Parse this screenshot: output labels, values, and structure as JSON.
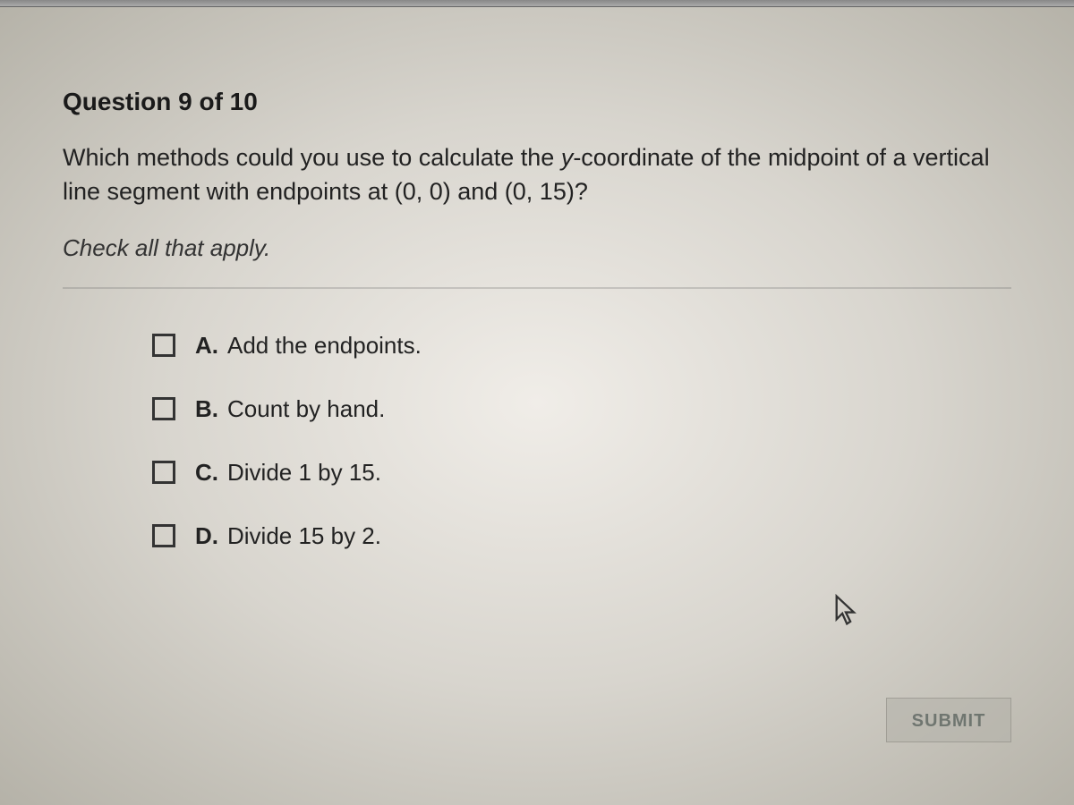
{
  "header": {
    "title": "Question 9 of 10"
  },
  "question": {
    "text_before_var": "Which methods could you use to calculate the ",
    "var": "y",
    "text_after_var": "-coordinate of the midpoint of a vertical line segment with endpoints at (0, 0) and (0, 15)?",
    "instruction": "Check all that apply."
  },
  "options": [
    {
      "letter": "A.",
      "text": "Add the endpoints."
    },
    {
      "letter": "B.",
      "text": "Count by hand."
    },
    {
      "letter": "C.",
      "text": "Divide 1 by 15."
    },
    {
      "letter": "D.",
      "text": "Divide 15 by 2."
    }
  ],
  "buttons": {
    "submit": "SUBMIT"
  }
}
